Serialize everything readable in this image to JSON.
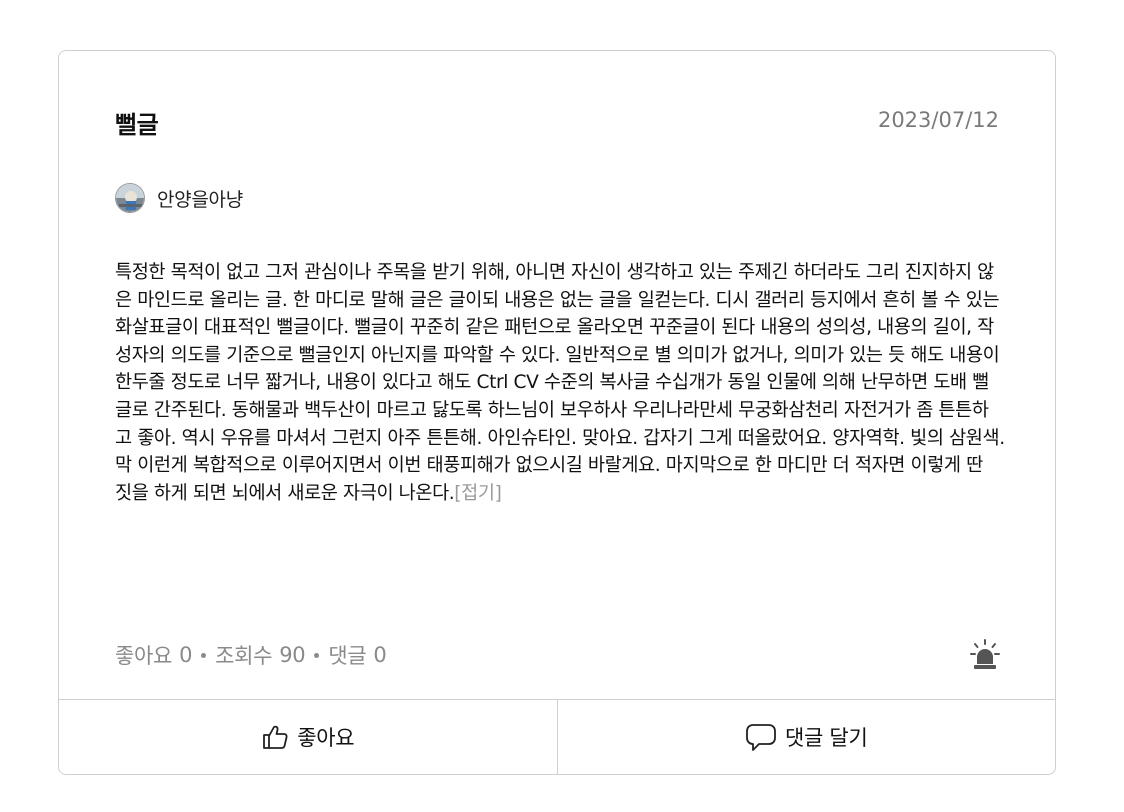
{
  "post": {
    "title": "뻘글",
    "date": "2023/07/12",
    "author": "안양을아냥",
    "body": "특정한 목적이 없고 그저 관심이나 주목을 받기 위해, 아니면 자신이 생각하고 있는 주제긴 하더라도 그리 진지하지 않은 마인드로 올리는 글. 한 마디로 말해 글은 글이되 내용은 없는 글을 일컫는다. 디시 갤러리 등지에서 흔히 볼 수 있는 화살표글이 대표적인 뻘글이다. 뻘글이 꾸준히 같은 패턴으로 올라오면 꾸준글이 된다 내용의 성의성, 내용의 길이, 작성자의 의도를 기준으로 뻘글인지 아닌지를 파악할 수 있다. 일반적으로 별 의미가 없거나, 의미가 있는 듯 해도 내용이 한두줄 정도로 너무 짧거나, 내용이 있다고 해도 Ctrl CV 수준의 복사글 수십개가 동일 인물에 의해 난무하면 도배 뻘글로 간주된다. 동해물과 백두산이 마르고 닳도록 하느님이 보우하사 우리나라만세 무궁화삼천리 자전거가 좀 튼튼하고 좋아. 역시 우유를 마셔서 그런지 아주 튼튼해. 아인슈타인. 맞아요. 갑자기 그게 떠올랐어요. 양자역학. 빛의 삼원색. 막 이런게 복합적으로 이루어지면서 이번 태풍피해가 없으시길 바랄게요. 마지막으로 한 마디만 더 적자면 이렇게 딴 짓을 하게 되면 뇌에서 새로운 자극이 나온다.",
    "fold_label": "[접기]"
  },
  "stats": {
    "likes_label": "좋아요",
    "likes_count": "0",
    "views_label": "조회수",
    "views_count": "90",
    "comments_label": "댓글",
    "comments_count": "0"
  },
  "actions": {
    "like_label": "좋아요",
    "comment_label": "댓글 달기"
  },
  "icons": {
    "like": "thumbs-up-icon",
    "comment": "speech-bubble-icon",
    "report": "siren-icon",
    "avatar": "profile-avatar"
  },
  "colors": {
    "border": "#cfcfcf",
    "muted_text": "#8a8a8a",
    "body_text": "#111111"
  }
}
